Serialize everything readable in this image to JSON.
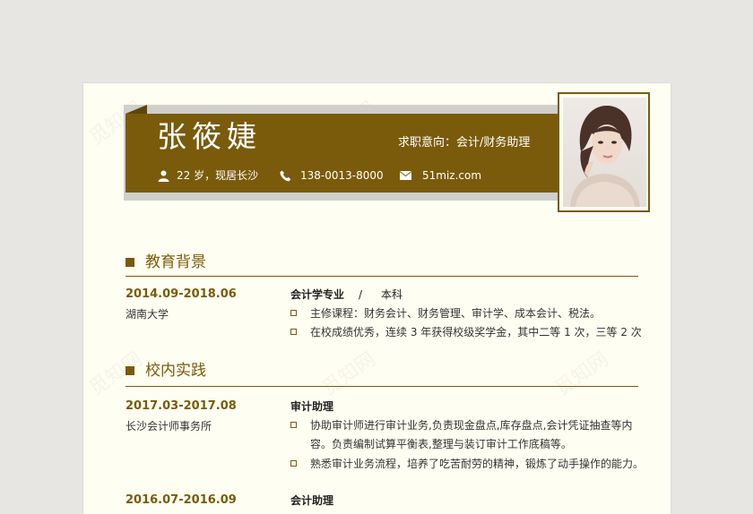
{
  "resume": {
    "name": "张筱婕",
    "intent": "求职意向：会计/财务助理",
    "age_location": "22 岁，现居长沙",
    "phone": "138-0013-8000",
    "email": "51miz.com",
    "watermark": "觅知网"
  },
  "education": {
    "title": "教育背景",
    "date": "2014.09-2018.06",
    "school": "湖南大学",
    "major": "会计学专业",
    "separator": "/",
    "degree": "本科",
    "bullets": [
      "主修课程：财务会计、财务管理、审计学、成本会计、税法。",
      "在校成绩优秀，连续 3 年获得校级奖学金，其中二等 1 次，三等 2 次"
    ]
  },
  "practice": {
    "title": "校内实践",
    "entries": [
      {
        "date": "2017.03-2017.08",
        "org": "长沙会计师事务所",
        "role": "审计助理",
        "bullets": [
          "协助审计师进行审计业务,负责现金盘点,库存盘点,会计凭证抽查等内",
          "容。负责编制试算平衡表,整理与装订审计工作底稿等。",
          "熟悉审计业务流程，培养了吃苦耐劳的精神，锻炼了动手操作的能力。"
        ]
      },
      {
        "date": "2016.07-2016.09",
        "role": "会计助理"
      }
    ]
  },
  "colors": {
    "accent": "#7a5b0b",
    "paper": "#fefef2",
    "background": "#e7e6e3"
  }
}
